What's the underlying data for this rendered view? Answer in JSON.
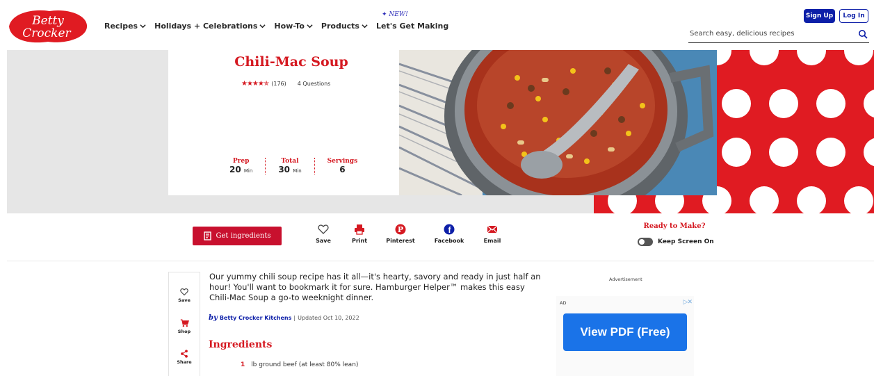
{
  "brand": {
    "logo_text_1": "Betty",
    "logo_text_2": "Crocker",
    "logo_color": "#e01b22"
  },
  "nav": {
    "items": [
      "Recipes",
      "Holidays + Celebrations",
      "How-To",
      "Products"
    ],
    "featured": {
      "label": "Let's Get Making",
      "badge": "NEW!"
    }
  },
  "account": {
    "signup": "Sign Up",
    "login": "Log In"
  },
  "search": {
    "placeholder": "Search easy, delicious recipes"
  },
  "recipe": {
    "title": "Chili-Mac Soup",
    "rating_count": "(176)",
    "questions": "4 Questions",
    "stats": [
      {
        "label": "Prep",
        "value": "20",
        "unit": "Min"
      },
      {
        "label": "Total",
        "value": "30",
        "unit": "Min"
      },
      {
        "label": "Servings",
        "value": "6",
        "unit": ""
      }
    ]
  },
  "actions": {
    "get_ingredients": "Get ingredients",
    "save": "Save",
    "print": "Print",
    "pinterest": "Pinterest",
    "facebook": "Facebook",
    "email": "Email"
  },
  "ready": {
    "title": "Ready to Make?",
    "keep_screen": "Keep Screen On"
  },
  "rail": {
    "save": "Save",
    "shop": "Shop",
    "share": "Share"
  },
  "article": {
    "intro": "Our yummy chili soup recipe has it all—it's hearty, savory and ready in just half an hour! You'll want to bookmark it for sure. Hamburger Helper™ makes this easy Chili-Mac Soup a go-to weeknight dinner.",
    "by": "by",
    "author": "Betty Crocker Kitchens",
    "updated": "Updated Oct 10, 2022",
    "ingredients_heading": "Ingredients",
    "first_ingredient_qty": "1",
    "first_ingredient": "lb ground beef (at least 80% lean)"
  },
  "ad": {
    "label": "Advertisement",
    "tag": "AD",
    "button": "View PDF (Free)"
  },
  "colors": {
    "accent_red": "#d51921",
    "brand_blue": "#0d1fa8",
    "ad_blue": "#1a73e8"
  }
}
